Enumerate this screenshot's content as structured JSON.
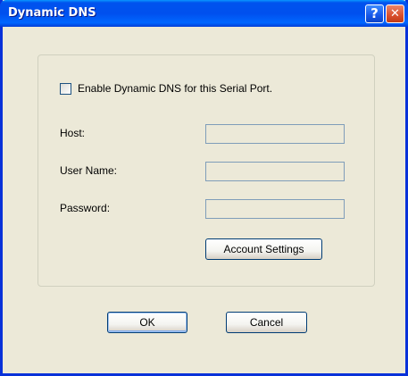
{
  "window": {
    "title": "Dynamic DNS",
    "help_button_label": "?",
    "close_button_label": "✕"
  },
  "form": {
    "enable_checkbox_label": "Enable Dynamic DNS for this Serial Port.",
    "enable_checked": false,
    "host": {
      "label": "Host:",
      "value": ""
    },
    "username": {
      "label": "User Name:",
      "value": ""
    },
    "password": {
      "label": "Password:",
      "value": ""
    },
    "account_settings_label": "Account Settings"
  },
  "footer": {
    "ok_label": "OK",
    "cancel_label": "Cancel"
  },
  "colors": {
    "titlebar": "#0053ee",
    "frame": "#0831d9",
    "dialog_bg": "#ece9d8",
    "field_border": "#7f9db9",
    "button_border": "#003c74",
    "close_button": "#d9502d"
  },
  "icons": {
    "help": "question-mark-icon",
    "close": "close-x-icon"
  }
}
